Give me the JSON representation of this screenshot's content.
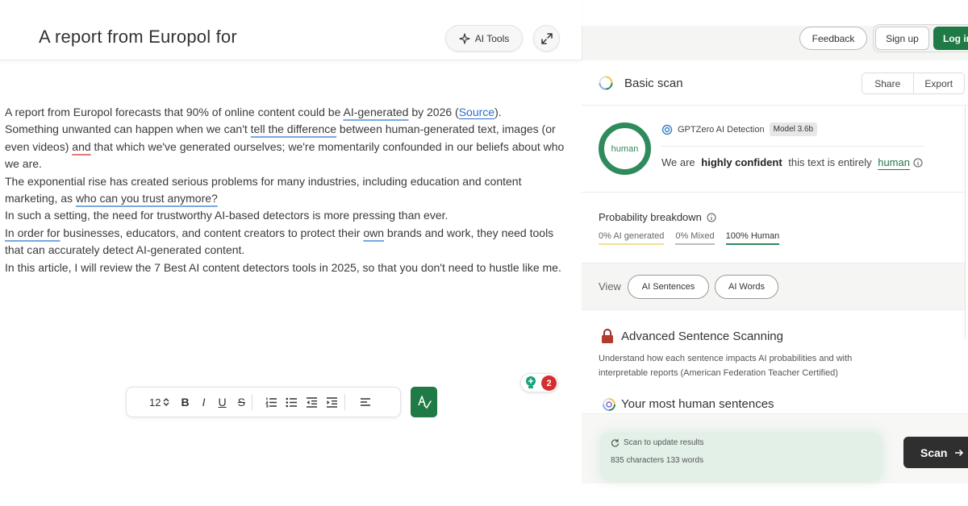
{
  "document": {
    "title": "A report from Europol for",
    "paragraphs": [
      {
        "segments": [
          {
            "text": "A report from Europol forecasts that 90% of online content could be ",
            "style": "plain"
          },
          {
            "text": "AI-generated",
            "style": "ul-blue"
          },
          {
            "text": " by 2026 (",
            "style": "plain"
          },
          {
            "text": "Source",
            "style": "link"
          },
          {
            "text": ").",
            "style": "plain"
          }
        ]
      },
      {
        "segments": [
          {
            "text": "Something unwanted can happen when we can't ",
            "style": "plain"
          },
          {
            "text": "tell the difference",
            "style": "ul-blue"
          },
          {
            "text": " between human-generated text, images (or even videos) ",
            "style": "plain"
          },
          {
            "text": "and",
            "style": "ul-red"
          },
          {
            "text": " that which we've generated ourselves; we're momentarily confounded in our beliefs about who we are.",
            "style": "plain"
          }
        ]
      },
      {
        "segments": [
          {
            "text": "The exponential rise has created serious problems for many industries, including education and content marketing, as ",
            "style": "plain"
          },
          {
            "text": "who can you trust anymore?",
            "style": "ul-blue"
          }
        ]
      },
      {
        "segments": [
          {
            "text": "In such a setting, the need for trustworthy AI-based detectors is more pressing than ever.",
            "style": "plain"
          }
        ]
      },
      {
        "segments": [
          {
            "text": "In order for",
            "style": "ul-blue"
          },
          {
            "text": " businesses, educators, and content creators to protect their ",
            "style": "plain"
          },
          {
            "text": "own",
            "style": "ul-blue"
          },
          {
            "text": " brands and work, they need tools that can accurately detect AI-generated content.",
            "style": "plain"
          }
        ]
      },
      {
        "segments": [
          {
            "text": "In this article, I will review the 7 Best AI content detectors tools in 2025, so that you don't need to hustle like me.",
            "style": "plain"
          }
        ]
      }
    ]
  },
  "header": {
    "ai_tools_label": "AI Tools"
  },
  "toolbar": {
    "font_size": "12",
    "bold": "B",
    "italic": "I",
    "underline": "U",
    "strike": "S"
  },
  "notification": {
    "count": "2"
  },
  "topbar": {
    "feedback_label": "Feedback",
    "signup_label": "Sign up",
    "login_label": "Log in"
  },
  "scan": {
    "title": "Basic scan",
    "share_label": "Share",
    "export_label": "Export"
  },
  "result": {
    "ring_label": "human",
    "detector_name": "GPTZero AI Detection",
    "model_badge": "Model 3.6b",
    "verdict_prefix": "We are ",
    "verdict_strong": "highly confident",
    "verdict_middle": " this text is entirely ",
    "verdict_word": "human"
  },
  "probability": {
    "title": "Probability breakdown",
    "ai": "0% AI generated",
    "mixed": "0% Mixed",
    "human": "100% Human"
  },
  "view": {
    "label": "View",
    "sentences_label": "AI Sentences",
    "words_label": "AI Words"
  },
  "advanced": {
    "title": "Advanced Sentence Scanning",
    "description": "Understand how each sentence impacts AI probabilities and with interpretable reports (American Federation Teacher Certified)",
    "most_human_title": "Your most human sentences"
  },
  "footer": {
    "scan_update": "Scan to update results",
    "char_count": "835 characters 133 words",
    "scan_label": "Scan"
  },
  "colors": {
    "brand_green": "#1f7a45",
    "ring_green": "#2f8a5c",
    "badge_red": "#d32f2f",
    "underline_blue": "#7aa7e0"
  }
}
